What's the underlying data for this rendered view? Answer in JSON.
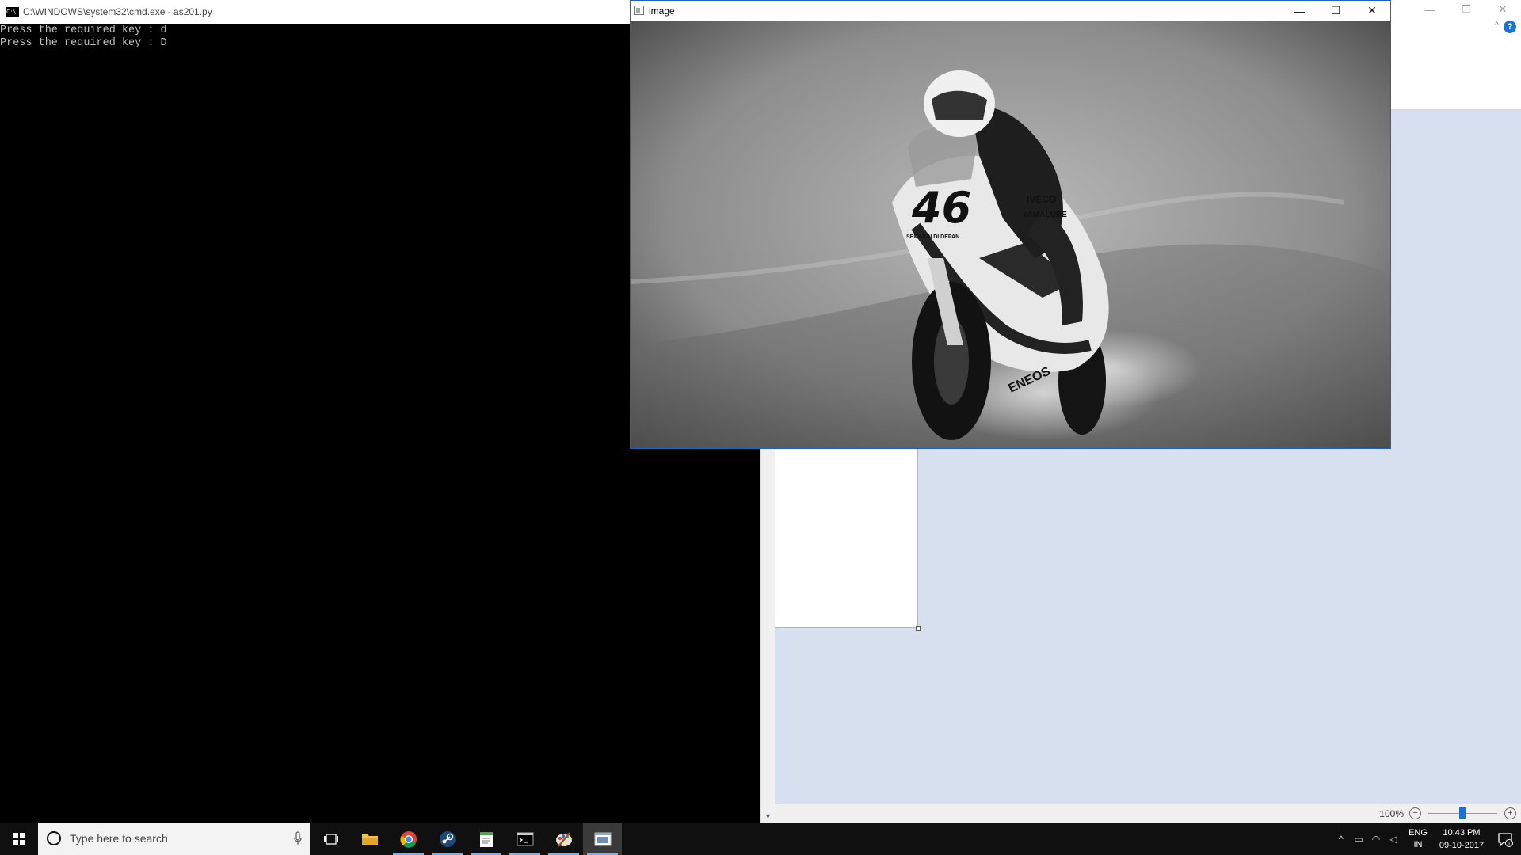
{
  "cmd_window": {
    "title": "C:\\WINDOWS\\system32\\cmd.exe - as201.py",
    "icon_text": "C:\\",
    "lines": [
      "Press the required key : d",
      "Press the required key : D"
    ]
  },
  "image_window": {
    "title": "image",
    "controls": {
      "minimize": "—",
      "maximize": "☐",
      "close": "✕"
    },
    "photo": {
      "bike_number": "46",
      "sponsors": [
        "IVECO",
        "YAMALUBE",
        "ENEOS",
        "SEMAKIN DI DEPAN"
      ]
    }
  },
  "paint_app": {
    "controls": {
      "minimize": "—",
      "restore": "❐",
      "close": "✕"
    },
    "help_label": "?",
    "collapse_label": "^",
    "zoom_level": "100%",
    "zoom_minus": "−",
    "zoom_plus": "+"
  },
  "taskbar": {
    "search_placeholder": "Type here to search",
    "apps": [
      {
        "name": "task-view",
        "active": false
      },
      {
        "name": "file-explorer",
        "active": false
      },
      {
        "name": "chrome",
        "active": true
      },
      {
        "name": "steam",
        "active": true
      },
      {
        "name": "notepad",
        "active": true
      },
      {
        "name": "cmd",
        "active": true
      },
      {
        "name": "paint",
        "active": true
      },
      {
        "name": "image-viewer",
        "active": true
      }
    ],
    "tray": {
      "lang_top": "ENG",
      "lang_bottom": "IN",
      "time": "10:43 PM",
      "date": "09-10-2017",
      "notification_count": "1"
    }
  },
  "colors": {
    "accent": "#1a63c8",
    "taskbar": "#101010",
    "canvas_bg": "#d6e0ee"
  }
}
